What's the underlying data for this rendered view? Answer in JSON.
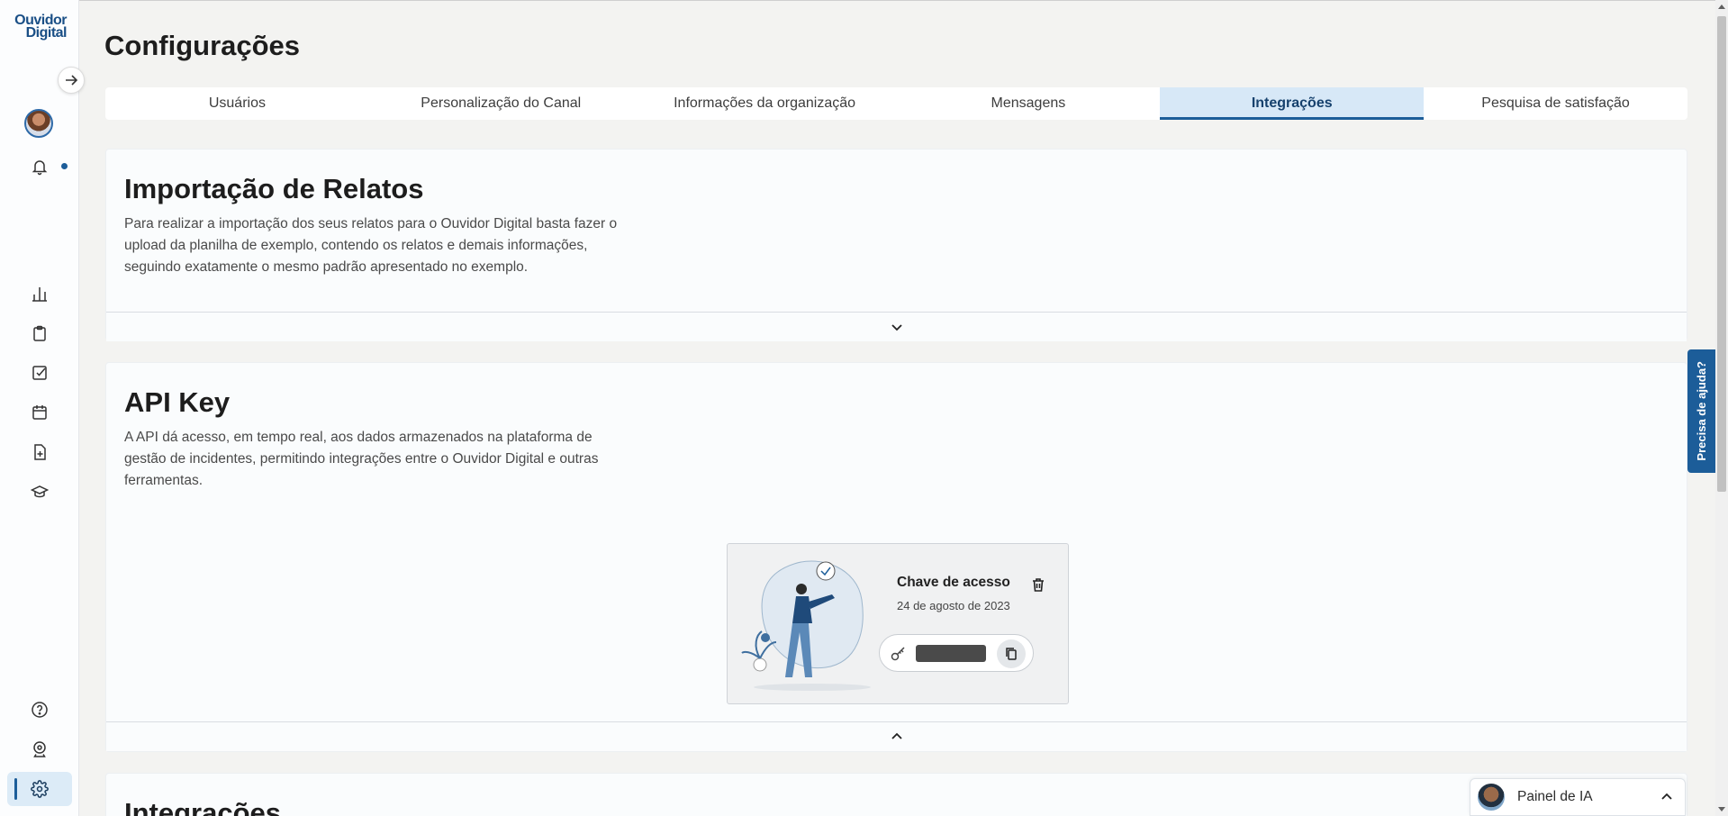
{
  "sidebar": {
    "logo_line1": "Ouvidor",
    "logo_line2": "Digital"
  },
  "page": {
    "title": "Configurações"
  },
  "tabs": [
    {
      "label": "Usuários"
    },
    {
      "label": "Personalização do Canal"
    },
    {
      "label": "Informações da organização"
    },
    {
      "label": "Mensagens"
    },
    {
      "label": "Integrações"
    },
    {
      "label": "Pesquisa de satisfação"
    }
  ],
  "active_tab": "Integrações",
  "import_section": {
    "title": "Importação de Relatos",
    "description": "Para realizar a importação dos seus relatos para o Ouvidor Digital basta fazer o upload da planilha de exemplo, contendo os relatos e demais informações, seguindo exatamente o mesmo padrão apresentado no exemplo."
  },
  "api_section": {
    "title": "API Key",
    "description": "A API dá acesso, em tempo real, aos dados armazenados na plataforma de gestão de incidentes, permitindo integrações entre o Ouvidor Digital e outras ferramentas.",
    "key_card": {
      "title": "Chave de acesso",
      "date": "24 de agosto de 2023"
    }
  },
  "integrations_section": {
    "title": "Integrações"
  },
  "help_tab": {
    "label": "Precisa de ajuda?"
  },
  "ai_panel": {
    "label": "Painel de IA"
  },
  "colors": {
    "accent": "#1c5d99",
    "active_tab_bg": "#d7e8f7",
    "background": "#f3f3f1"
  }
}
